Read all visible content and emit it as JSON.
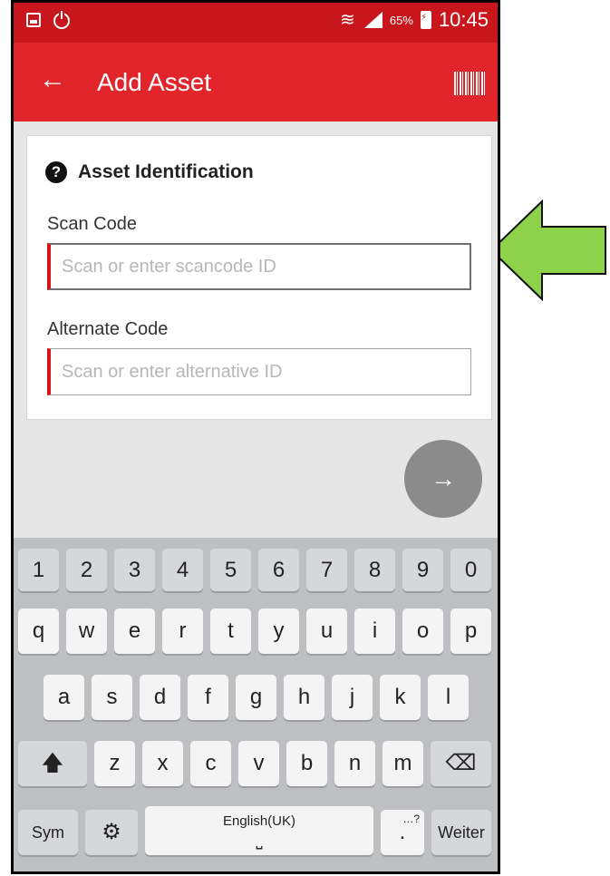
{
  "status_bar": {
    "battery_percent": "65%",
    "time": "10:45"
  },
  "app_bar": {
    "title": "Add Asset"
  },
  "form": {
    "section_title": "Asset Identification",
    "scan_code": {
      "label": "Scan Code",
      "value": "",
      "placeholder": "Scan or enter scancode ID"
    },
    "alternate_code": {
      "label": "Alternate Code",
      "value": "",
      "placeholder": "Scan or enter alternative ID"
    }
  },
  "keyboard": {
    "row1": [
      "1",
      "2",
      "3",
      "4",
      "5",
      "6",
      "7",
      "8",
      "9",
      "0"
    ],
    "row2": [
      "q",
      "w",
      "e",
      "r",
      "t",
      "y",
      "u",
      "i",
      "o",
      "p"
    ],
    "row3": [
      "a",
      "s",
      "d",
      "f",
      "g",
      "h",
      "j",
      "k",
      "l"
    ],
    "row4": [
      "z",
      "x",
      "c",
      "v",
      "b",
      "n",
      "m"
    ],
    "sym_label": "Sym",
    "space_label": "English(UK)",
    "period_label": ".",
    "period_hint": "…?",
    "enter_label": "Weiter"
  },
  "colors": {
    "primary": "#e2252b",
    "status_bar": "#c8161c",
    "pointer_arrow": "#8ed14a"
  }
}
